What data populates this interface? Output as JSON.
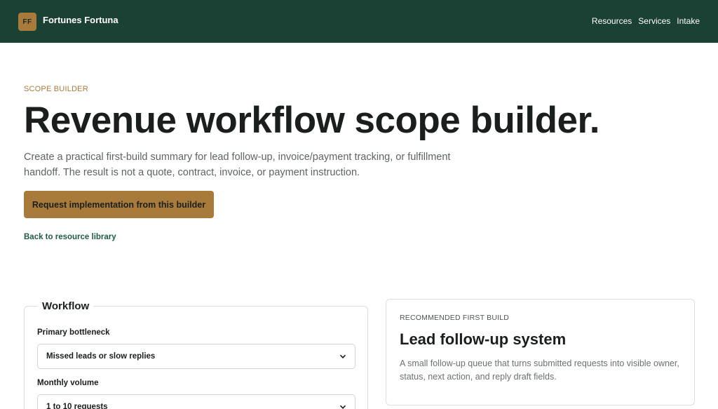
{
  "header": {
    "logo_initials": "FF",
    "brand_name": "Fortunes Fortuna",
    "nav": [
      "Resources",
      "Services",
      "Intake"
    ],
    "background_color": "#1b4034"
  },
  "hero": {
    "eyebrow": "SCOPE BUILDER",
    "title": "Revenue workflow scope builder.",
    "description": "Create a practical first-build summary for lead follow-up, invoice/payment tracking, or fulfillment handoff. The result is not a quote, contract, invoice, or payment instruction.",
    "cta_label": "Request implementation from this builder",
    "back_link": "Back to resource library",
    "accent_color": "#a87b3a"
  },
  "workflow": {
    "legend": "Workflow",
    "fields": [
      {
        "label": "Primary bottleneck",
        "value": "Missed leads or slow replies"
      },
      {
        "label": "Monthly volume",
        "value": "1 to 10 requests"
      }
    ]
  },
  "recommendation": {
    "eyebrow": "RECOMMENDED FIRST BUILD",
    "title": "Lead follow-up system",
    "description": "A small follow-up queue that turns submitted requests into visible owner, status, next action, and reply draft fields."
  }
}
